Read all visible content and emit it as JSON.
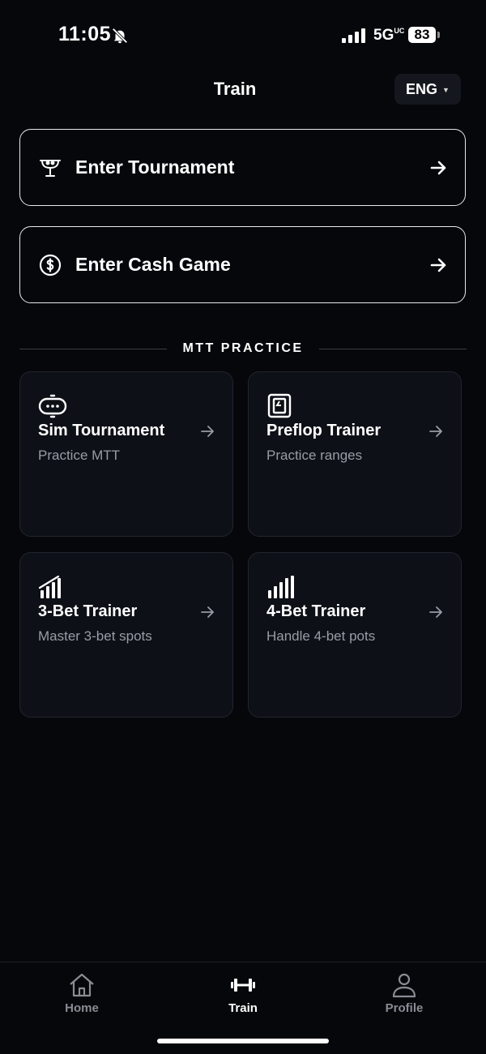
{
  "status_bar": {
    "time": "11:05",
    "network": "5G",
    "network_suffix": "UC",
    "battery": "83"
  },
  "header": {
    "title": "Train",
    "language": "ENG"
  },
  "entries": [
    {
      "label": "Enter Tournament",
      "icon": "trophy-icon"
    },
    {
      "label": "Enter Cash Game",
      "icon": "dollar-coin-icon"
    }
  ],
  "section": {
    "title": "MTT PRACTICE"
  },
  "practice_cards": [
    {
      "title": "Sim Tournament",
      "subtitle": "Practice MTT",
      "icon": "poker-table-icon"
    },
    {
      "title": "Preflop Trainer",
      "subtitle": "Practice ranges",
      "icon": "card-icon"
    },
    {
      "title": "3-Bet Trainer",
      "subtitle": "Master 3-bet spots",
      "icon": "rising-bars-icon"
    },
    {
      "title": "4-Bet Trainer",
      "subtitle": "Handle 4-bet pots",
      "icon": "rising-bars-icon"
    }
  ],
  "tabs": [
    {
      "label": "Home",
      "icon": "home-icon",
      "active": false
    },
    {
      "label": "Train",
      "icon": "dumbbell-icon",
      "active": true
    },
    {
      "label": "Profile",
      "icon": "person-icon",
      "active": false
    }
  ],
  "colors": {
    "background": "#06070b",
    "card": "#0e1017",
    "text": "#ffffff",
    "muted": "#9a9ca5",
    "inactive_tab": "#8a8c94"
  }
}
